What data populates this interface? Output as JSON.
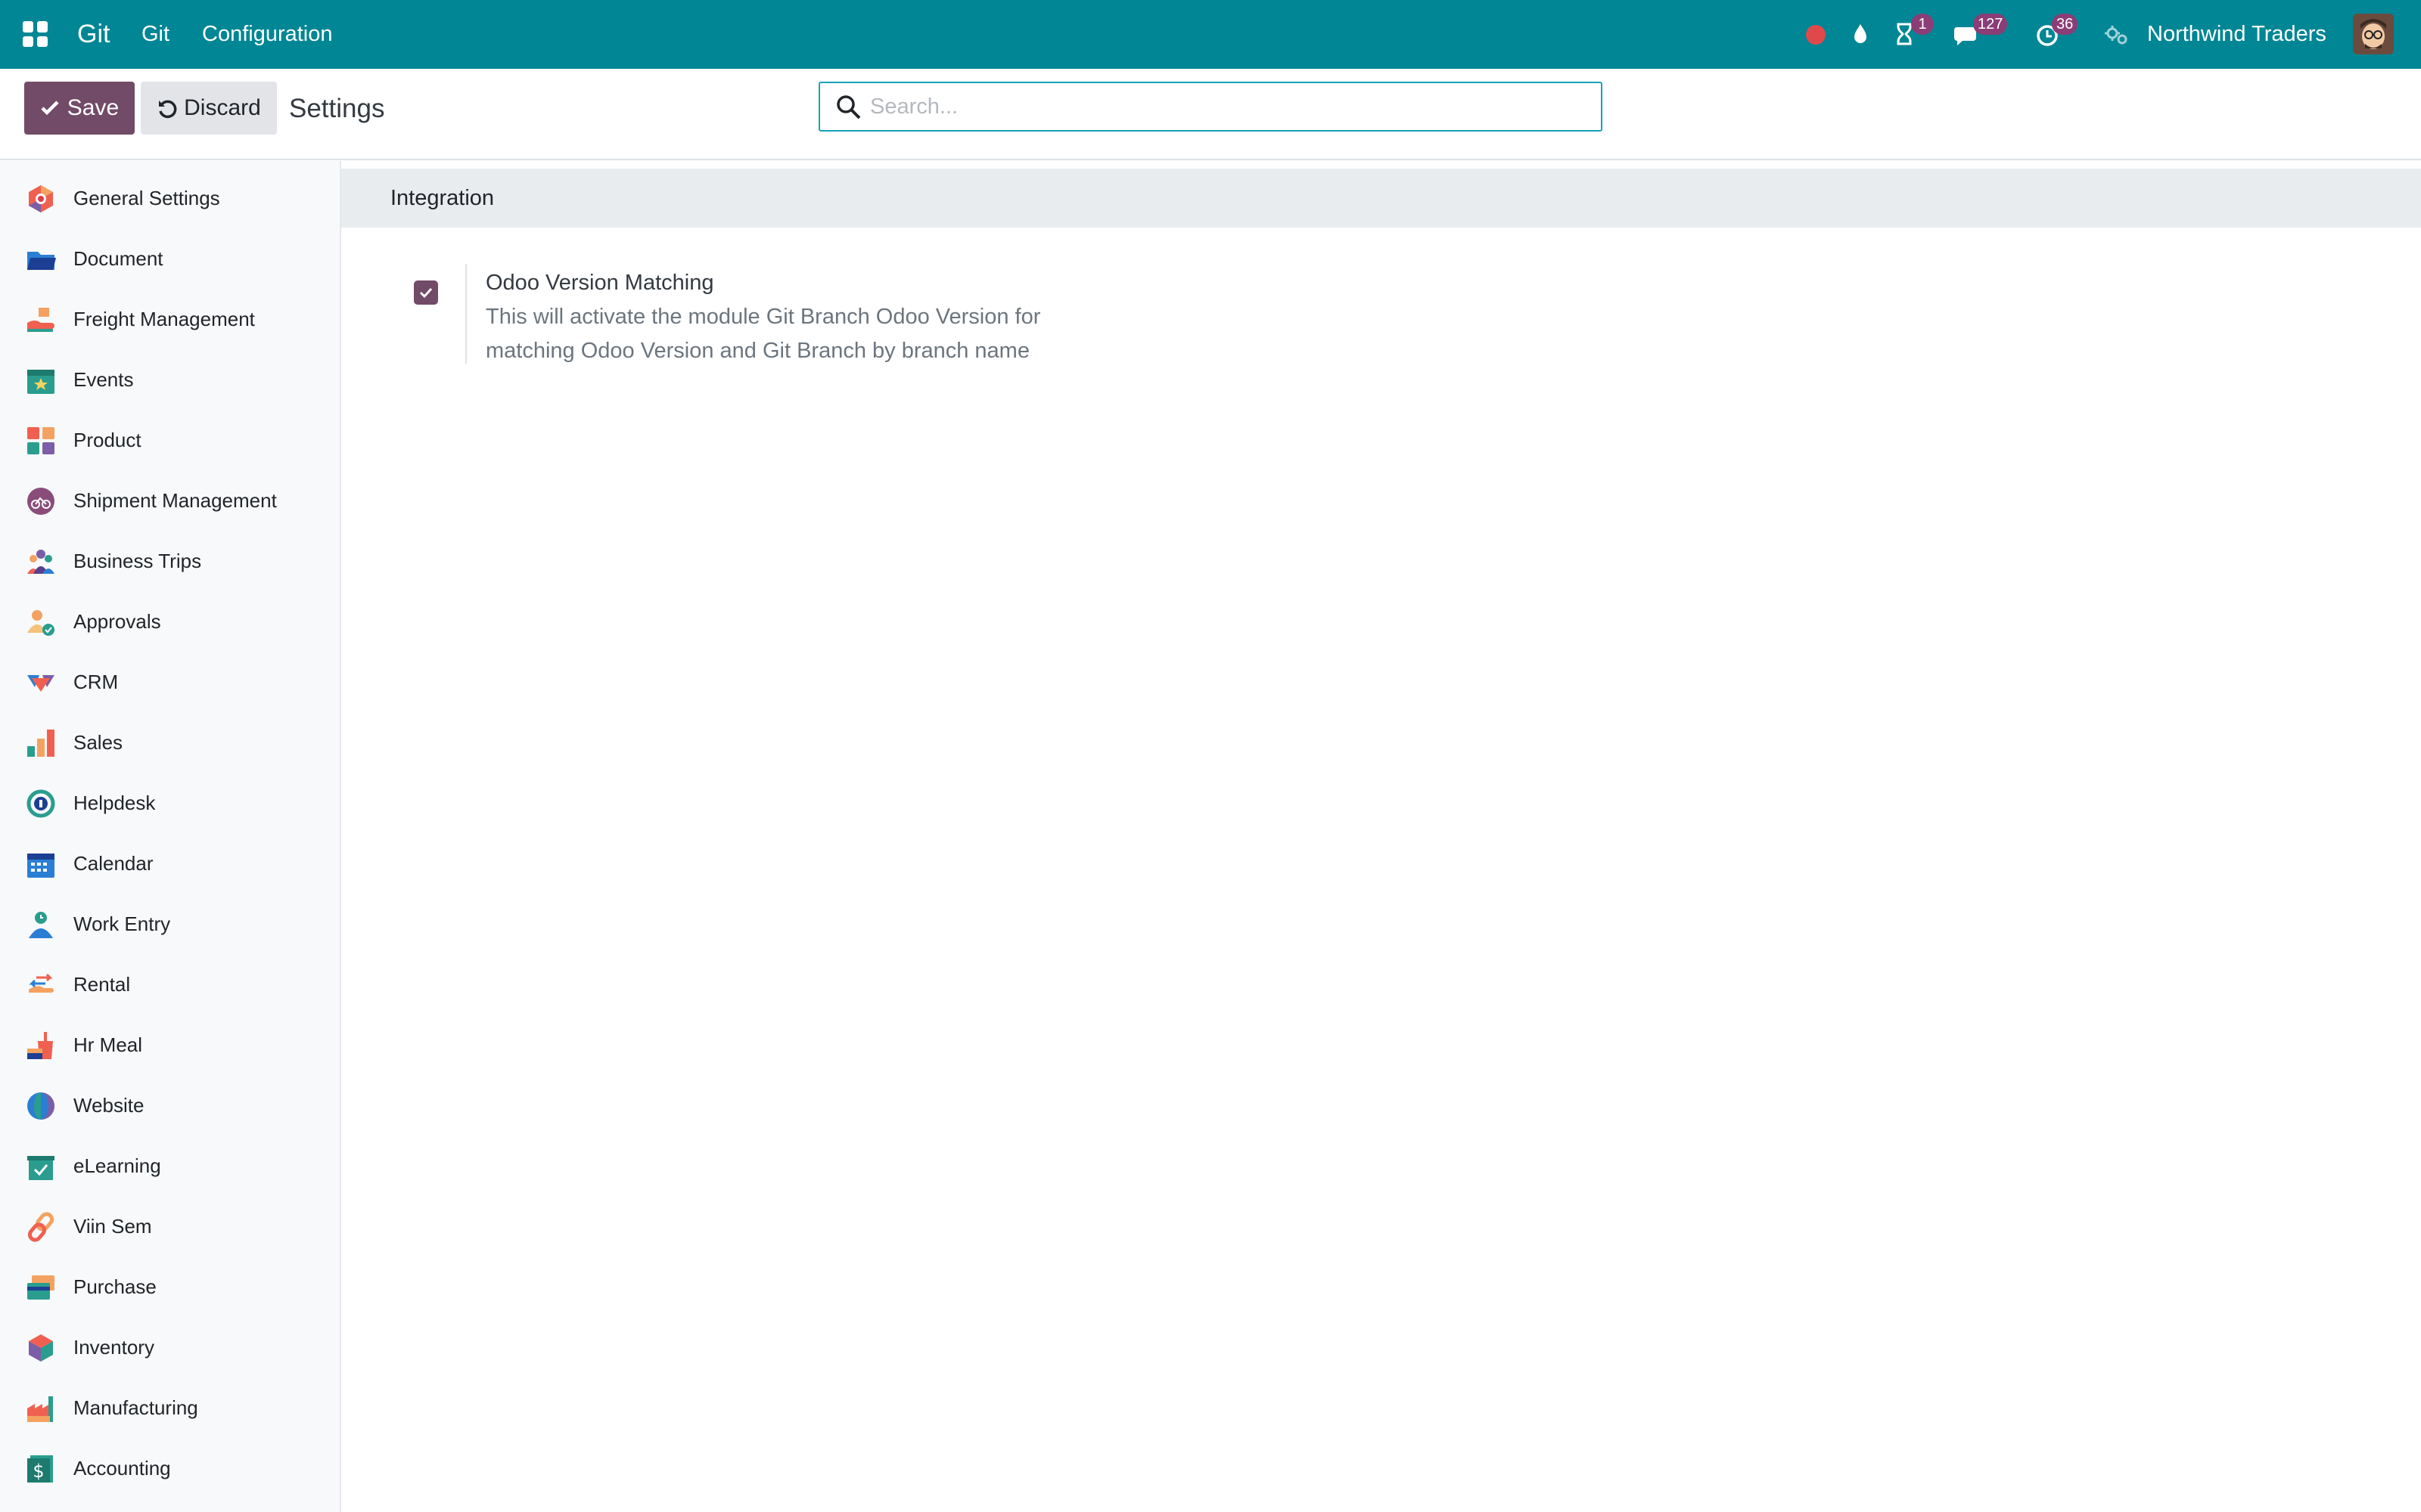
{
  "navbar": {
    "brand": "Git",
    "menu": [
      "Git",
      "Configuration"
    ],
    "activities_count": "1",
    "messages_count": "127",
    "timer_count": "36",
    "company": "Northwind Traders",
    "bg_color": "#008694"
  },
  "control_panel": {
    "save_label": "Save",
    "discard_label": "Discard",
    "title": "Settings",
    "search_placeholder": "Search..."
  },
  "sidebar": {
    "items": [
      {
        "label": "General Settings",
        "icon": "general-settings-icon"
      },
      {
        "label": "Document",
        "icon": "folder-icon"
      },
      {
        "label": "Freight Management",
        "icon": "freight-icon"
      },
      {
        "label": "Events",
        "icon": "calendar-star-icon"
      },
      {
        "label": "Product",
        "icon": "product-blocks-icon"
      },
      {
        "label": "Shipment Management",
        "icon": "bike-icon"
      },
      {
        "label": "Business Trips",
        "icon": "people-icon"
      },
      {
        "label": "Approvals",
        "icon": "user-check-icon"
      },
      {
        "label": "CRM",
        "icon": "handshake-icon"
      },
      {
        "label": "Sales",
        "icon": "bar-chart-icon"
      },
      {
        "label": "Helpdesk",
        "icon": "headset-icon"
      },
      {
        "label": "Calendar",
        "icon": "calendar-icon"
      },
      {
        "label": "Work Entry",
        "icon": "user-clock-icon"
      },
      {
        "label": "Rental",
        "icon": "hand-icon"
      },
      {
        "label": "Hr Meal",
        "icon": "meal-icon"
      },
      {
        "label": "Website",
        "icon": "globe-icon"
      },
      {
        "label": "eLearning",
        "icon": "elearning-box-icon"
      },
      {
        "label": "Viin Sem",
        "icon": "link-icon"
      },
      {
        "label": "Purchase",
        "icon": "credit-card-icon"
      },
      {
        "label": "Inventory",
        "icon": "cube-icon"
      },
      {
        "label": "Manufacturing",
        "icon": "factory-icon"
      },
      {
        "label": "Accounting",
        "icon": "dollar-doc-icon"
      }
    ]
  },
  "main": {
    "section_title": "Integration",
    "setting": {
      "checked": true,
      "title": "Odoo Version Matching",
      "desc_line1": "This will activate the module Git Branch Odoo Version for",
      "desc_line2": "matching Odoo Version and Git Branch by branch name"
    }
  },
  "colors": {
    "primary": "#714b67",
    "navbar": "#008694",
    "search_border": "#17a2b8"
  }
}
